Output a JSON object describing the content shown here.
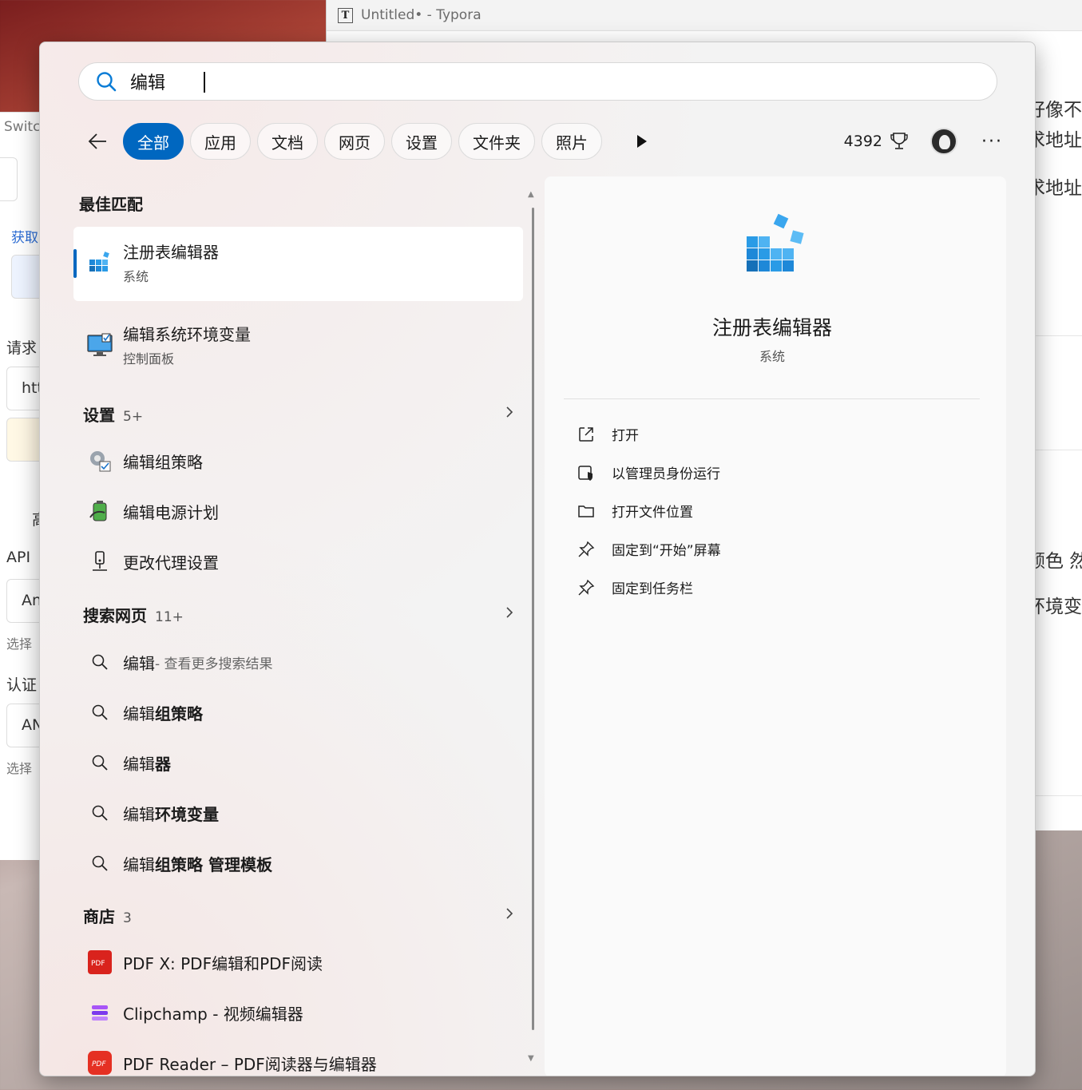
{
  "typora": {
    "title": "Untitled• - Typora",
    "fragments": [
      "好像不",
      "求地址",
      "求地址",
      "颜色 然",
      "环境变"
    ]
  },
  "bg_left": {
    "fragments": [
      "Switc",
      "获取",
      "请求",
      "htt",
      "高",
      "API",
      "An",
      "选择",
      "认证",
      "AN",
      "选择"
    ]
  },
  "search": {
    "value": "编辑",
    "icon": "search-icon"
  },
  "filters": {
    "tabs": [
      "全部",
      "应用",
      "文档",
      "网页",
      "设置",
      "文件夹",
      "照片"
    ],
    "active": "全部"
  },
  "rewards": {
    "points": "4392"
  },
  "sections": {
    "best_match": {
      "title": "最佳匹配"
    },
    "settings": {
      "title": "设置",
      "count": "5+"
    },
    "web": {
      "title": "搜索网页",
      "count": "11+"
    },
    "store": {
      "title": "商店",
      "count": "3"
    }
  },
  "best_match": {
    "name": "注册表编辑器",
    "sub": "系统"
  },
  "second_match": {
    "name": "编辑系统环境变量",
    "sub": "控制面板"
  },
  "settings_items": [
    "编辑组策略",
    "编辑电源计划",
    "更改代理设置"
  ],
  "web_items": [
    {
      "bold": "编辑",
      "rest": " - 查看更多搜索结果"
    },
    {
      "plain": "编辑",
      "bold": "组策略"
    },
    {
      "plain": "编辑",
      "bold": "器"
    },
    {
      "plain": "编辑",
      "bold": "环境变量"
    },
    {
      "plain": "编辑",
      "bold": "组策略 管理模板"
    }
  ],
  "store_items": [
    "PDF X: PDF编辑和PDF阅读",
    "Clipchamp - 视频编辑器",
    "PDF Reader – PDF阅读器与编辑器"
  ],
  "detail": {
    "name": "注册表编辑器",
    "sub": "系统",
    "actions": [
      "打开",
      "以管理员身份运行",
      "打开文件位置",
      "固定到“开始”屏幕",
      "固定到任务栏"
    ]
  },
  "colors": {
    "accent": "#0067c0"
  }
}
